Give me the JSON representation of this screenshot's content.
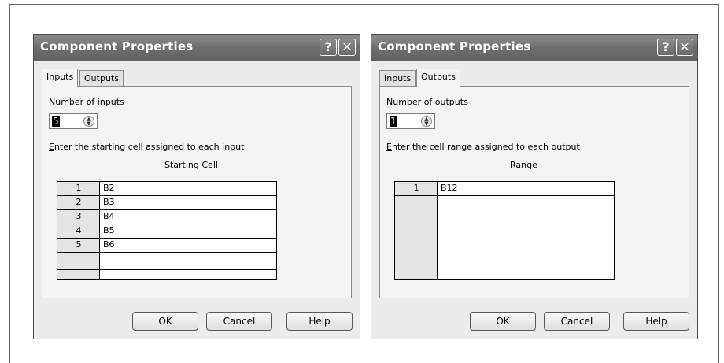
{
  "dialogs": [
    {
      "title": "Component Properties",
      "help_glyph": "?",
      "close_glyph": "✕",
      "tabs": [
        "Inputs",
        "Outputs"
      ],
      "active_tab": "Inputs",
      "count_label_pre": "N",
      "count_label_rest": "umber of inputs",
      "count_value": "5",
      "enter_label_pre": "E",
      "enter_label_rest": "nter the starting cell assigned to each input",
      "column_header": "Starting Cell",
      "rows": [
        {
          "num": "1",
          "cell": "B2"
        },
        {
          "num": "2",
          "cell": "B3"
        },
        {
          "num": "3",
          "cell": "B4"
        },
        {
          "num": "4",
          "cell": "B5"
        },
        {
          "num": "5",
          "cell": "B6"
        }
      ],
      "buttons": [
        "OK",
        "Cancel",
        "Help"
      ]
    },
    {
      "title": "Component Properties",
      "help_glyph": "?",
      "close_glyph": "✕",
      "tabs": [
        "Inputs",
        "Outputs"
      ],
      "active_tab": "Outputs",
      "count_label_pre": "N",
      "count_label_rest": "umber of outputs",
      "count_value": "1",
      "enter_label_pre": "E",
      "enter_label_rest": "nter the cell range assigned to each output",
      "column_header": "Range",
      "rows": [
        {
          "num": "1",
          "cell": "B12"
        }
      ],
      "buttons": [
        "OK",
        "Cancel",
        "Help"
      ]
    }
  ]
}
